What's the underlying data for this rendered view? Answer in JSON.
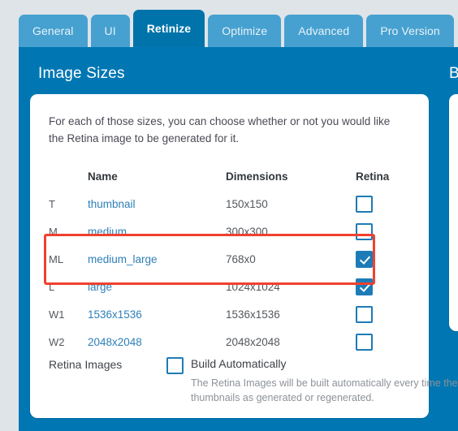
{
  "tabs": [
    {
      "label": "General",
      "active": false
    },
    {
      "label": "UI",
      "active": false
    },
    {
      "label": "Retinize",
      "active": true
    },
    {
      "label": "Optimize",
      "active": false
    },
    {
      "label": "Advanced",
      "active": false
    },
    {
      "label": "Pro Version",
      "active": false
    }
  ],
  "panel": {
    "title": "Image Sizes",
    "side_title": "B",
    "intro": "For each of those sizes, you can choose whether or not you would like the Retina image to be generated for it."
  },
  "table": {
    "headers": {
      "key": "",
      "name": "Name",
      "dimensions": "Dimensions",
      "retina": "Retina"
    },
    "rows": [
      {
        "key": "T",
        "name": "thumbnail",
        "dimensions": "150x150",
        "retina_checked": false,
        "highlighted": false
      },
      {
        "key": "M",
        "name": "medium",
        "dimensions": "300x300",
        "retina_checked": false,
        "highlighted": false
      },
      {
        "key": "ML",
        "name": "medium_large",
        "dimensions": "768x0",
        "retina_checked": true,
        "highlighted": true
      },
      {
        "key": "L",
        "name": "large",
        "dimensions": "1024x1024",
        "retina_checked": true,
        "highlighted": true
      },
      {
        "key": "W1",
        "name": "1536x1536",
        "dimensions": "1536x1536",
        "retina_checked": false,
        "highlighted": false
      },
      {
        "key": "W2",
        "name": "2048x2048",
        "dimensions": "2048x2048",
        "retina_checked": false,
        "highlighted": false
      }
    ]
  },
  "retina_images": {
    "label": "Retina Images",
    "checkbox_checked": false,
    "checkbox_label": "Build Automatically",
    "description": "The Retina Images will be built automatically every time the thumbnails as generated or regenerated."
  },
  "colors": {
    "page_background": "#dfe4e9",
    "panel_blue": "#0077b3",
    "tab_inactive": "#46a1d0",
    "tab_active": "#0073aa",
    "link_blue": "#2d7fb8",
    "checkbox_blue": "#1d7cb8",
    "highlight_red": "#f0412f"
  }
}
